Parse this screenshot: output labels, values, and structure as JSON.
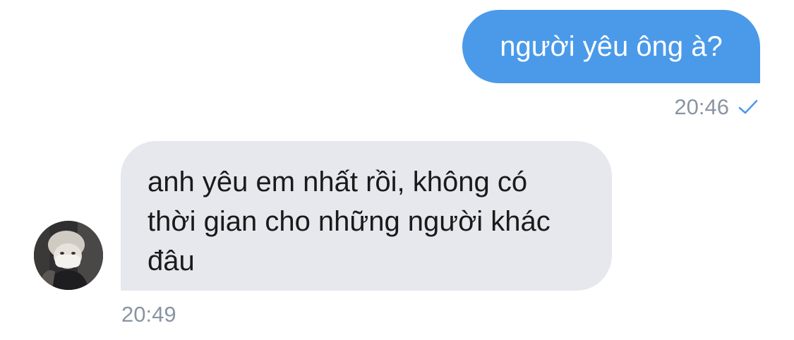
{
  "conversation": {
    "messages": [
      {
        "direction": "outgoing",
        "text": "người yêu ông à?",
        "time": "20:46",
        "status_icon": "check-icon"
      },
      {
        "direction": "incoming",
        "text": "anh yêu em nhất rồi, không có thời gian cho những người khác đâu",
        "time": "20:49",
        "avatar_icon": "contact-avatar"
      }
    ]
  },
  "colors": {
    "sent_bubble": "#4a9ae9",
    "received_bubble": "#e6e8ee",
    "timestamp": "#8a95a3",
    "check": "#4a9ae9"
  }
}
